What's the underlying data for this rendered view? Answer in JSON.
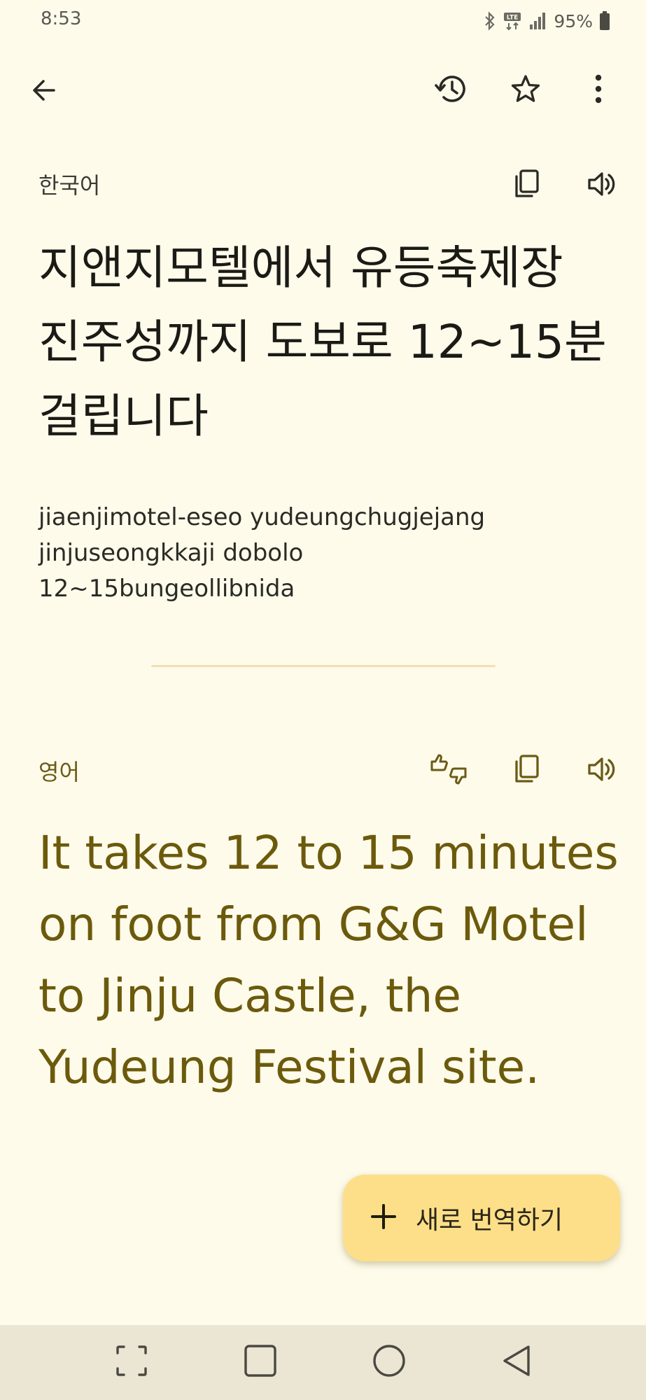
{
  "status_bar": {
    "time": "8:53",
    "battery": "95%",
    "network": "LTE"
  },
  "toolbar": {
    "back_icon": "arrow-left-icon",
    "history_icon": "history-icon",
    "star_icon": "star-outline-icon",
    "more_icon": "more-vert-icon"
  },
  "source": {
    "language": "한국어",
    "text": "지앤지모텔에서 유등축제장 진주성까지 도보로 12~15분걸립니다",
    "romanization": "jiaenjimotel-eseo yudeungchugjejang\njinjuseongkkaji dobolo\n12~15bungeollibnida",
    "copy_icon": "copy-icon",
    "speak_icon": "volume-icon"
  },
  "target": {
    "language": "영어",
    "text": "It takes 12 to 15 minutes on foot from G&G Motel to Jinju Castle, the Yudeung Festival site.",
    "feedback_icon": "thumbs-up-down-icon",
    "copy_icon": "copy-icon",
    "speak_icon": "volume-icon"
  },
  "fab": {
    "label": "새로 번역하기",
    "icon": "plus-icon"
  },
  "colors": {
    "background": "#fefbeb",
    "translation_text": "#6c5a0c",
    "fab": "#fcdf88",
    "divider": "#f1dfb4"
  }
}
